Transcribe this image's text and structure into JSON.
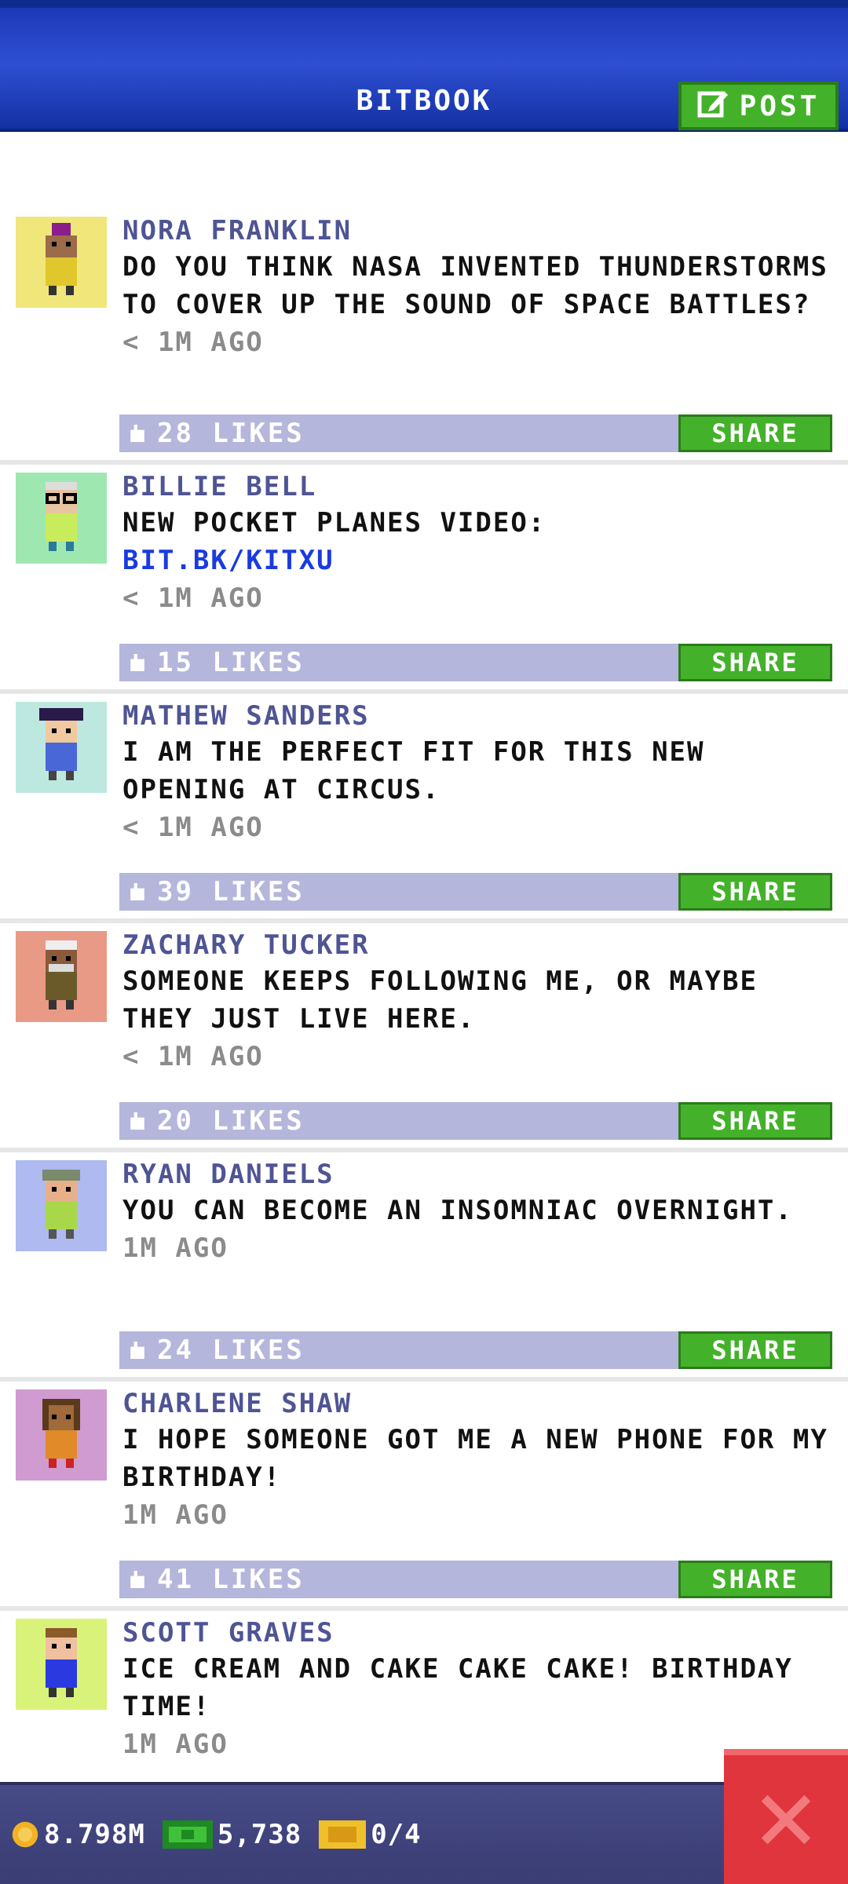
{
  "header": {
    "title": "BITBOOK",
    "post_label": "POST"
  },
  "posts": [
    {
      "author": "NORA FRANKLIN",
      "text": "DO YOU THINK NASA INVENTED THUNDERSTORMS TO COVER UP THE SOUND OF SPACE BATTLES?",
      "link": "",
      "time": "< 1M AGO",
      "likes": "28 LIKES",
      "share": "SHARE",
      "avatar_bg": "#f0e67a"
    },
    {
      "author": "BILLIE BELL",
      "text": "NEW POCKET PLANES VIDEO:",
      "link": "BIT.BK/KITXU",
      "time": "< 1M AGO",
      "likes": "15 LIKES",
      "share": "SHARE",
      "avatar_bg": "#9fe7b1"
    },
    {
      "author": "MATHEW SANDERS",
      "text": "I AM THE PERFECT FIT FOR THIS NEW OPENING AT CIRCUS.",
      "link": "",
      "time": "< 1M AGO",
      "likes": "39 LIKES",
      "share": "SHARE",
      "avatar_bg": "#bde8e0"
    },
    {
      "author": "ZACHARY TUCKER",
      "text": "SOMEONE KEEPS FOLLOWING ME, OR MAYBE THEY JUST LIVE HERE.",
      "link": "",
      "time": "< 1M AGO",
      "likes": "20 LIKES",
      "share": "SHARE",
      "avatar_bg": "#e99a86"
    },
    {
      "author": "RYAN DANIELS",
      "text": "YOU CAN BECOME AN INSOMNIAC OVERNIGHT.",
      "link": "",
      "time": "1M AGO",
      "likes": "24 LIKES",
      "share": "SHARE",
      "avatar_bg": "#aebaf0"
    },
    {
      "author": "CHARLENE SHAW",
      "text": "I HOPE SOMEONE GOT ME A NEW PHONE FOR MY BIRTHDAY!",
      "link": "",
      "time": "1M AGO",
      "likes": "41 LIKES",
      "share": "SHARE",
      "avatar_bg": "#cf9bd1"
    },
    {
      "author": "SCOTT GRAVES",
      "text": "ICE CREAM AND CAKE CAKE CAKE! BIRTHDAY TIME!",
      "link": "",
      "time": "1M AGO",
      "likes": "",
      "share": "",
      "avatar_bg": "#d9f27a"
    }
  ],
  "footer": {
    "coins": "8.798M",
    "bux": "5,738",
    "tickets": "0/4"
  },
  "icons": {
    "post": "edit-icon",
    "like": "thumb-icon",
    "coin": "coin-icon",
    "bux": "bux-icon",
    "ticket": "ticket-icon",
    "close": "close-icon"
  },
  "colors": {
    "header": "#1c39b6",
    "accent_green": "#44b12a",
    "likes_bar": "#b4b6db",
    "footer": "#474b86",
    "close": "#e0353c",
    "author": "#4f5494",
    "link": "#1a3be0"
  }
}
